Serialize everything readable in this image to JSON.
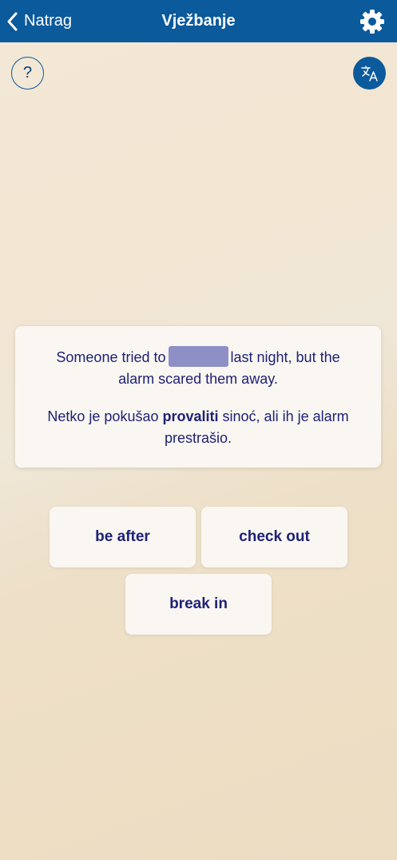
{
  "header": {
    "back_label": "Natrag",
    "title": "Vježbanje",
    "back_icon": "chevron-left-icon",
    "settings_icon": "gear-icon",
    "background_color": "#0b5a9c"
  },
  "help": {
    "label": "?"
  },
  "translate": {
    "icon": "translate-icon"
  },
  "exercise": {
    "sentence_before": "Someone tried to",
    "sentence_after": "last night, but the alarm scared them away.",
    "translation_before": "Netko je pokušao",
    "translation_keyword": "provaliti",
    "translation_after": "sinoć, ali ih je alarm prestrašio."
  },
  "options": [
    {
      "label": "be after"
    },
    {
      "label": "check out"
    },
    {
      "label": "break in"
    }
  ],
  "colors": {
    "accent": "#0b5a9c",
    "text": "#1e2277",
    "blank": "#8e8fc7"
  }
}
